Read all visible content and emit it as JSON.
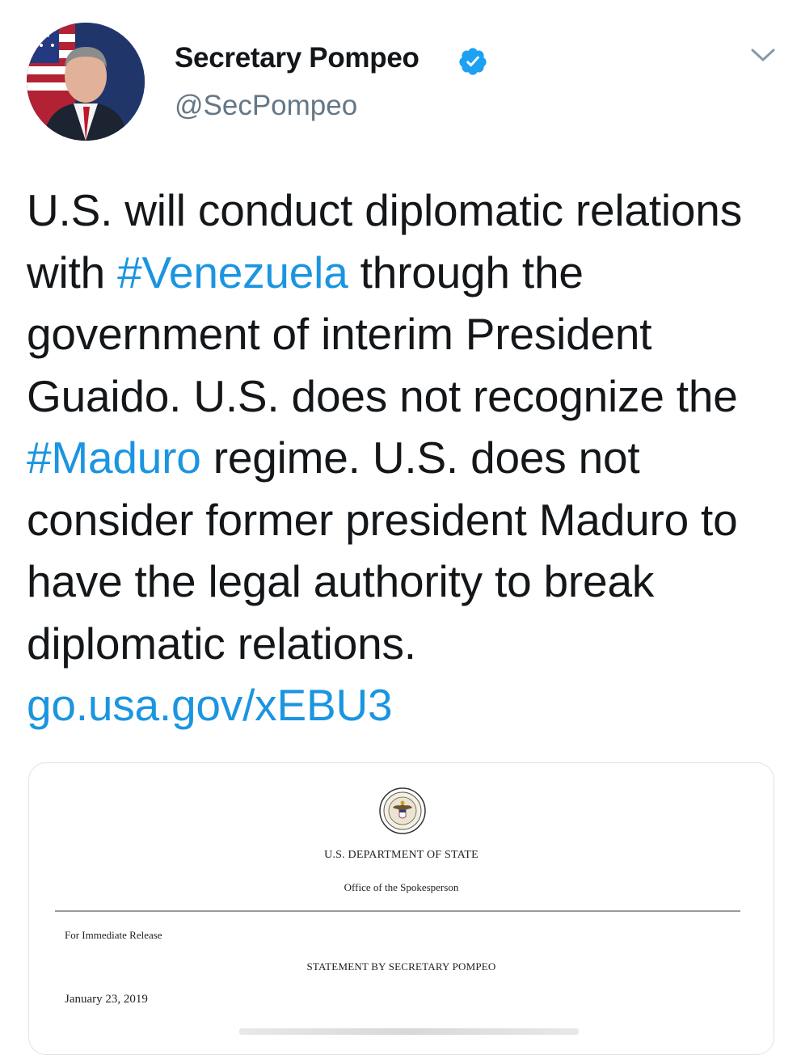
{
  "tweet": {
    "author": {
      "display_name": "Secretary Pompeo",
      "handle": "@SecPompeo",
      "verified": true,
      "avatar_icon": "profile-photo-avatar"
    },
    "menu_icon": "chevron-down-icon",
    "text_segments": [
      {
        "text": "U.S. will conduct diplomatic relations with ",
        "type": "text"
      },
      {
        "text": "#Venezuela",
        "type": "hashtag"
      },
      {
        "text": " through the government of interim President Guaido. U.S. does not recognize the ",
        "type": "text"
      },
      {
        "text": "#Maduro",
        "type": "hashtag"
      },
      {
        "text": " regime. U.S. does not consider former president Maduro to have the legal authority to break diplomatic relations. ",
        "type": "text"
      },
      {
        "text": "go.usa.gov/xEBU3",
        "type": "link"
      }
    ],
    "colors": {
      "text": "#14171a",
      "link": "#1b95e0",
      "handle": "#657786",
      "verified_badge": "#1da1f2"
    }
  },
  "card": {
    "seal_icon": "department-of-state-seal-icon",
    "department": "U.S. DEPARTMENT OF STATE",
    "office": "Office of the Spokesperson",
    "release_label": "For Immediate Release",
    "statement_title": "STATEMENT BY SECRETARY POMPEO",
    "date": "January 23, 2019"
  }
}
